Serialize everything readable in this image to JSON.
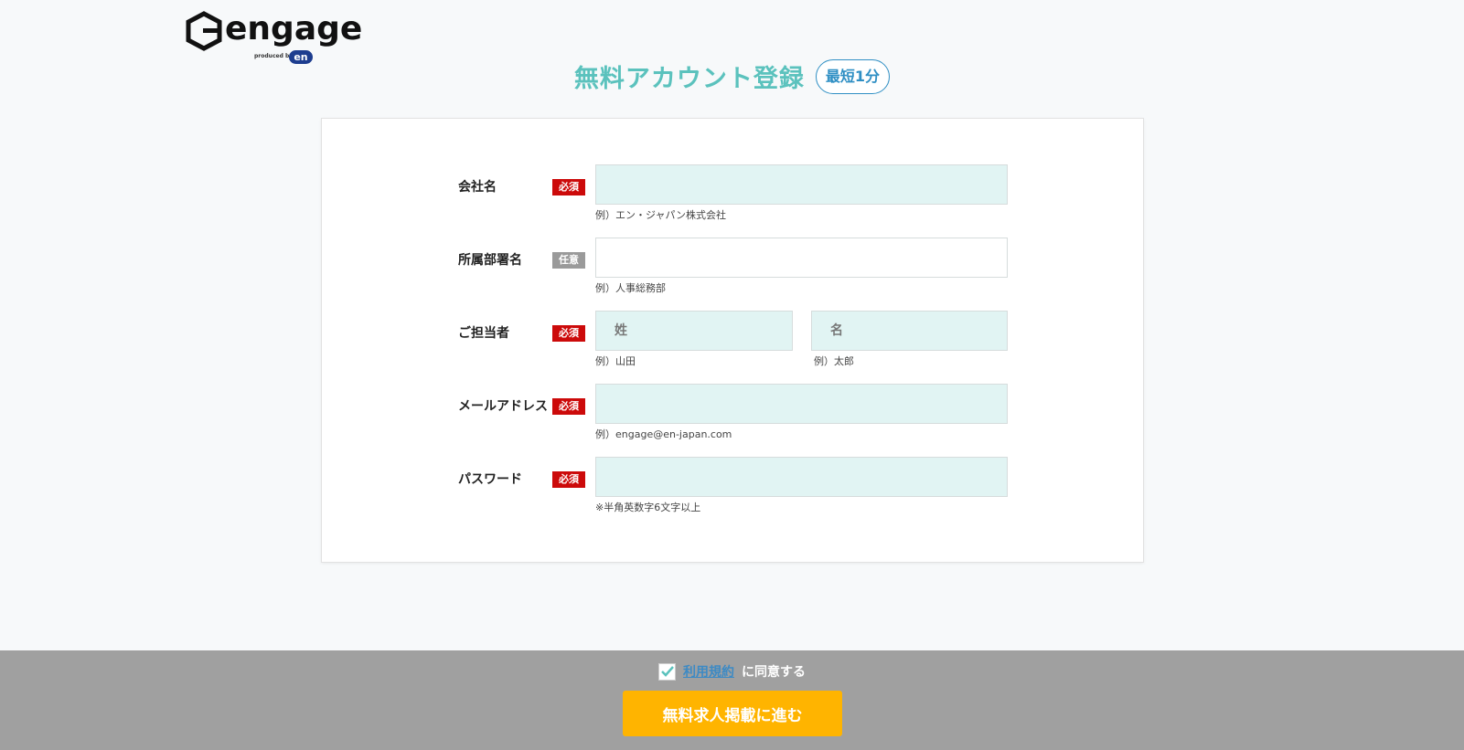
{
  "logo": {
    "word": "engage",
    "produced_by": "produced by",
    "en_mark": "en"
  },
  "header": {
    "title": "無料アカウント登録",
    "time_badge": "最短1分"
  },
  "form": {
    "company": {
      "label": "会社名",
      "badge": "必須",
      "value": "",
      "hint": "例）エン・ジャパン株式会社"
    },
    "department": {
      "label": "所属部署名",
      "badge": "任意",
      "value": "",
      "hint": "例）人事総務部"
    },
    "contact": {
      "label": "ご担当者",
      "badge": "必須",
      "last_name_placeholder": "姓",
      "first_name_placeholder": "名",
      "last_name_hint": "例）山田",
      "first_name_hint": "例）太郎"
    },
    "email": {
      "label": "メールアドレス",
      "badge": "必須",
      "value": "",
      "hint": "例）engage@en-japan.com"
    },
    "password": {
      "label": "パスワード",
      "badge": "必須",
      "value": "",
      "hint": "※半角英数字6文字以上"
    }
  },
  "footer": {
    "terms_link": "利用規約",
    "agree_text": "に同意する",
    "agree_checked": true,
    "submit_label": "無料求人掲載に進む"
  },
  "colors": {
    "title": "#5bc2bd",
    "required": "#cc0a0a",
    "optional": "#9a9a9a",
    "input_bg": "#e1f4f3",
    "submit": "#ffb400",
    "footer": "#a0a0a0",
    "link": "#3d8ac4"
  }
}
